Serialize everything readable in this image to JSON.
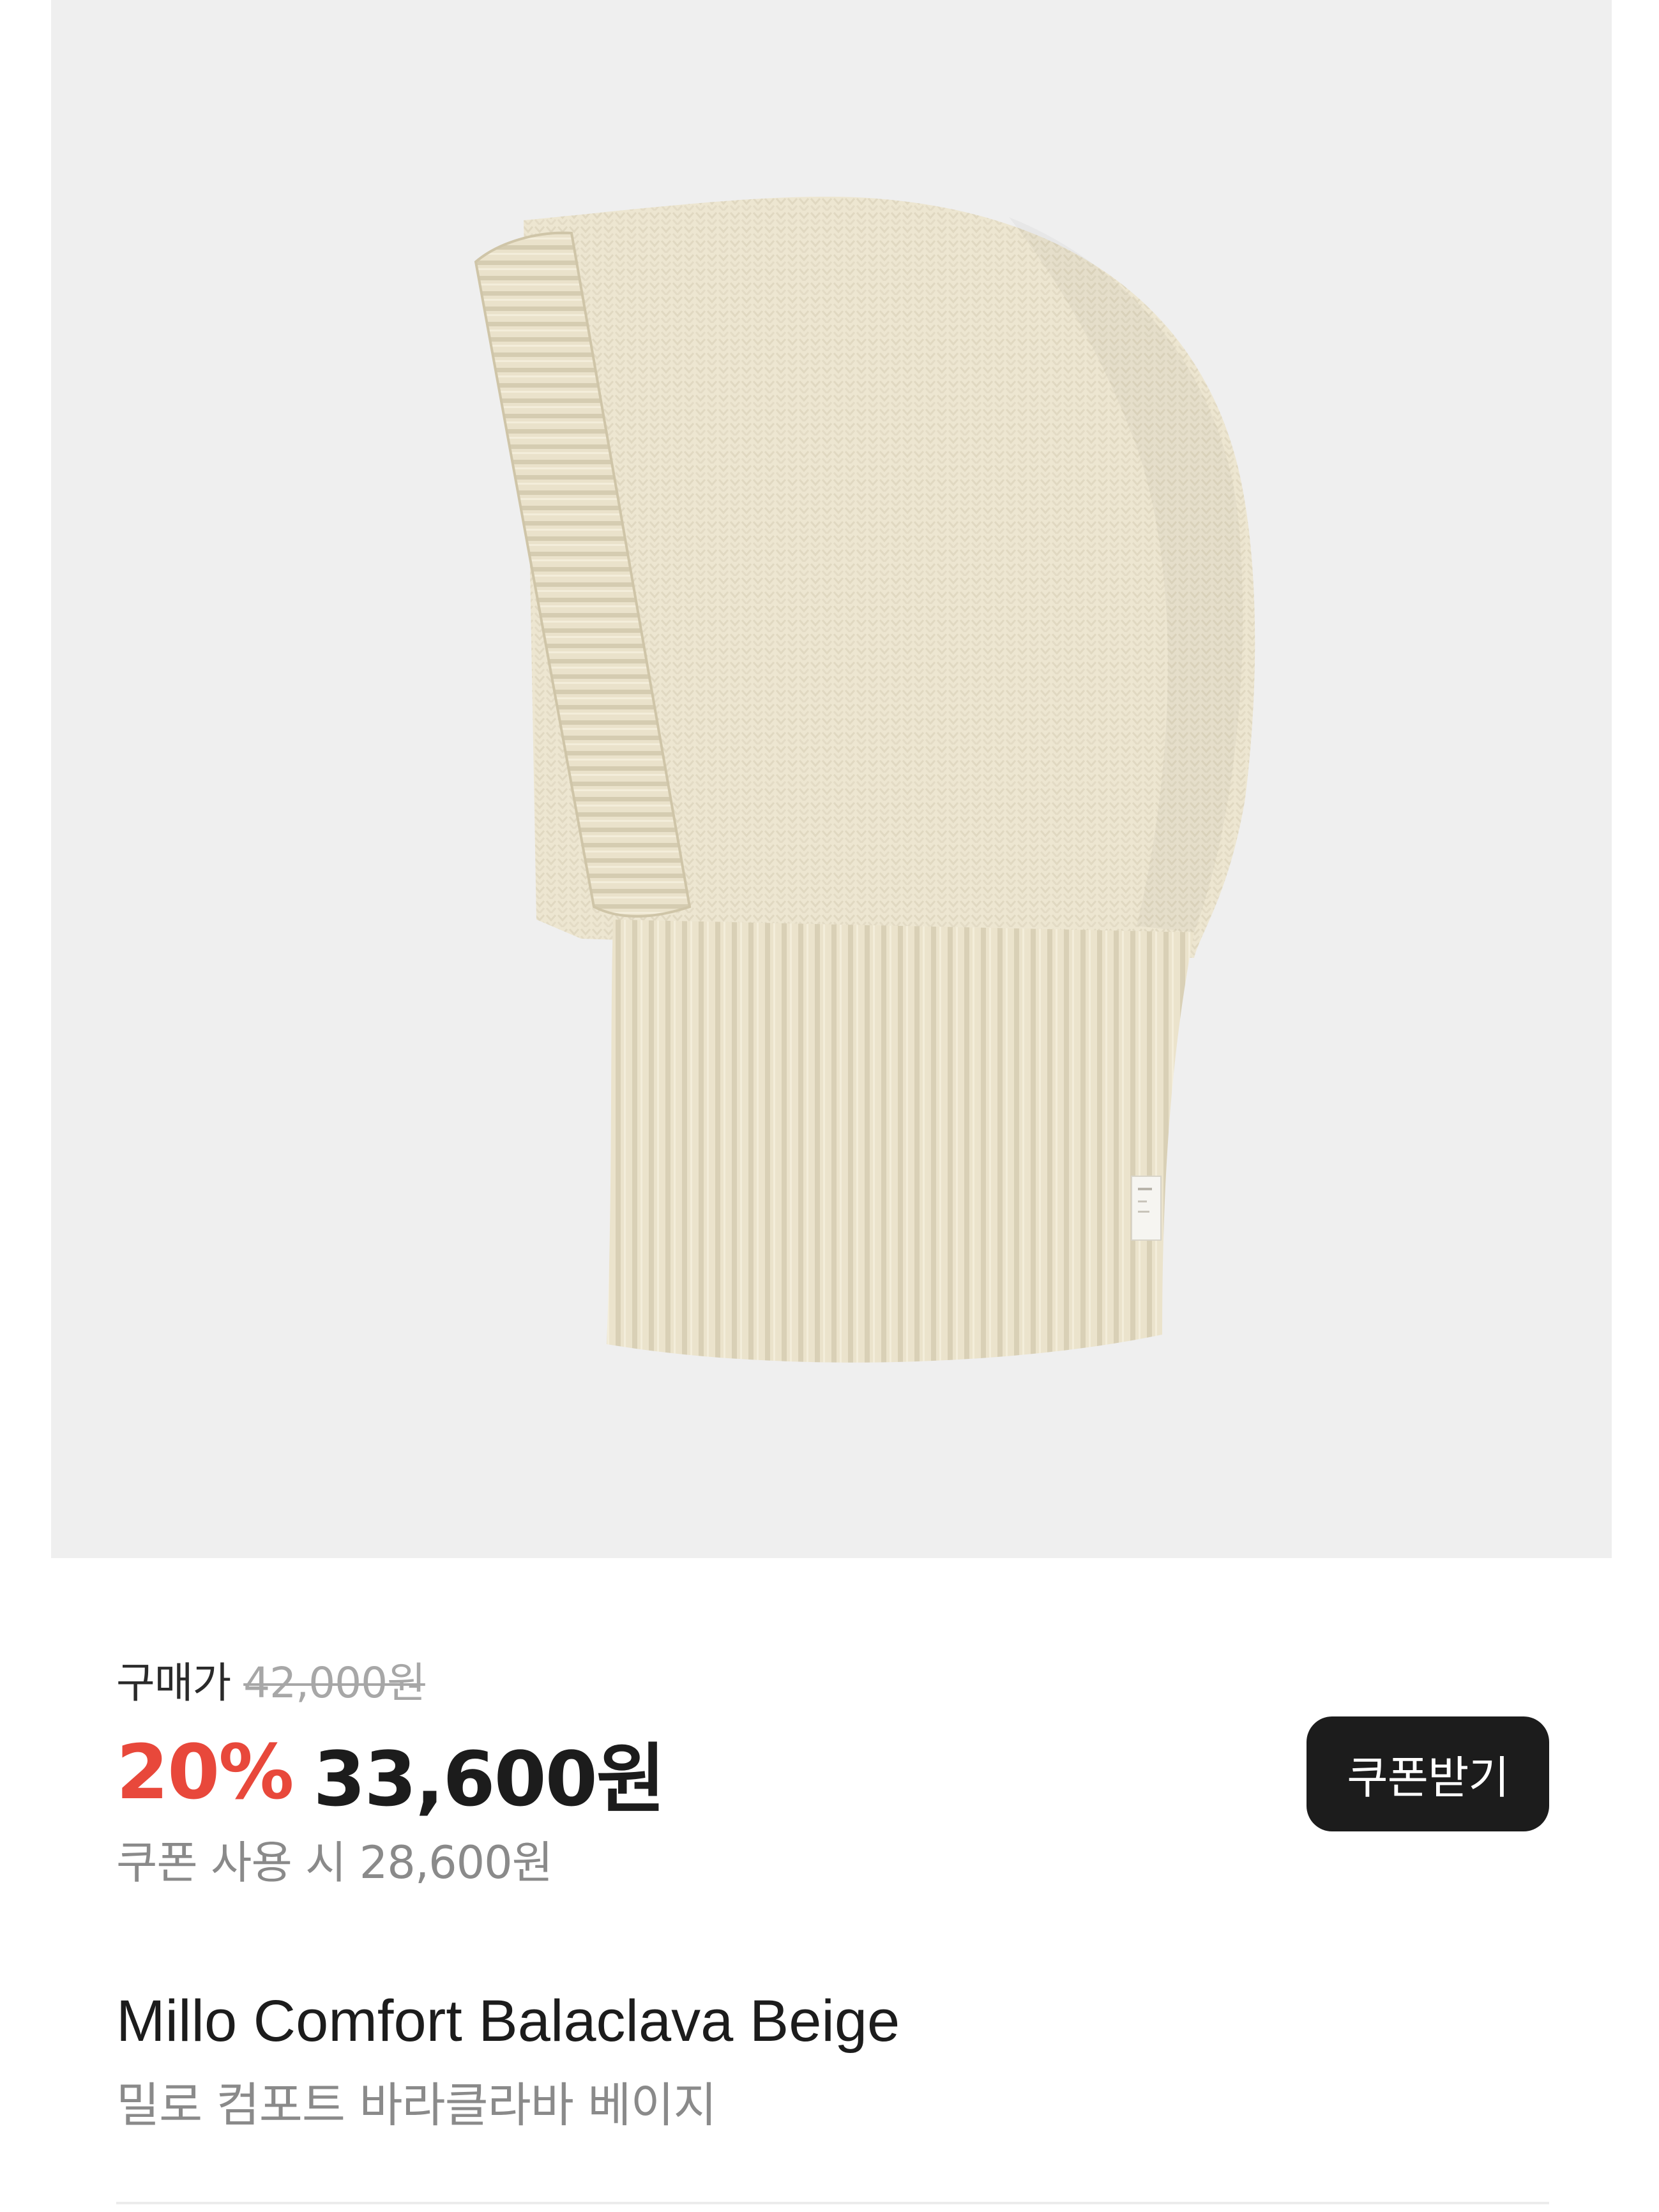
{
  "product_image": {
    "icon": "knit-balaclava-photo",
    "background_color": "#efefef",
    "knit_color": "#eee7d2"
  },
  "pricing": {
    "label": "구매가",
    "original_price": "42,000원",
    "discount_rate": "20%",
    "sale_price": "33,600원",
    "coupon_price_text": "쿠폰 사용 시 28,600원",
    "accent_color": "#e8483b"
  },
  "coupon_button": {
    "label": "쿠폰받기"
  },
  "product": {
    "name": "Millo Comfort Balaclava Beige",
    "name_ko": "밀로 컴포트 바라클라바 베이지"
  }
}
